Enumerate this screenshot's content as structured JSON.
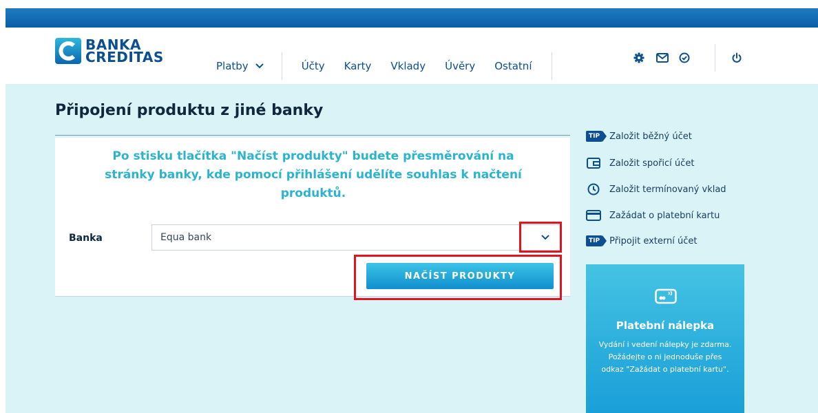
{
  "logo": {
    "line1": "BANKA",
    "line2": "CREDITAS"
  },
  "nav": {
    "platby": "Platby",
    "ucty": "Účty",
    "karty": "Karty",
    "vklady": "Vklady",
    "uvery": "Úvěry",
    "ostatni": "Ostatní"
  },
  "header_icons": [
    "gear-icon",
    "envelope-icon",
    "check-circle-icon",
    "power-icon"
  ],
  "page": {
    "title": "Připojení produktu z jiné banky"
  },
  "card": {
    "intro": "Po stisku tlačítka \"Načíst produkty\" budete přesměrování na stránky banky, kde pomocí přihlášení udělíte souhlas k načtení produktů.",
    "bank_label": "Banka",
    "bank_value": "Equa bank",
    "load_button": "NAČÍST PRODUKTY"
  },
  "sidebar": {
    "items": [
      {
        "label": "Založit běžný účet",
        "icon": "tip-badge"
      },
      {
        "label": "Založit spořicí účet",
        "icon": "wallet-icon"
      },
      {
        "label": "Založit termínovaný vklad",
        "icon": "clock-icon"
      },
      {
        "label": "Zažádat o platební kartu",
        "icon": "card-icon"
      },
      {
        "label": "Připojit externí účet",
        "icon": "tip-badge"
      }
    ],
    "tip_text": "TIP"
  },
  "promo": {
    "title": "Platební nálepka",
    "text": "Vydání i vedení nálepky je zdarma. Požádejte o ni jednoduše přes odkaz \"Zažádat o platební kartu\"."
  },
  "colors": {
    "brand": "#0b4f92",
    "accent": "#2bb3cf",
    "highlight": "#e0141e",
    "background": "#d9f3f6"
  }
}
